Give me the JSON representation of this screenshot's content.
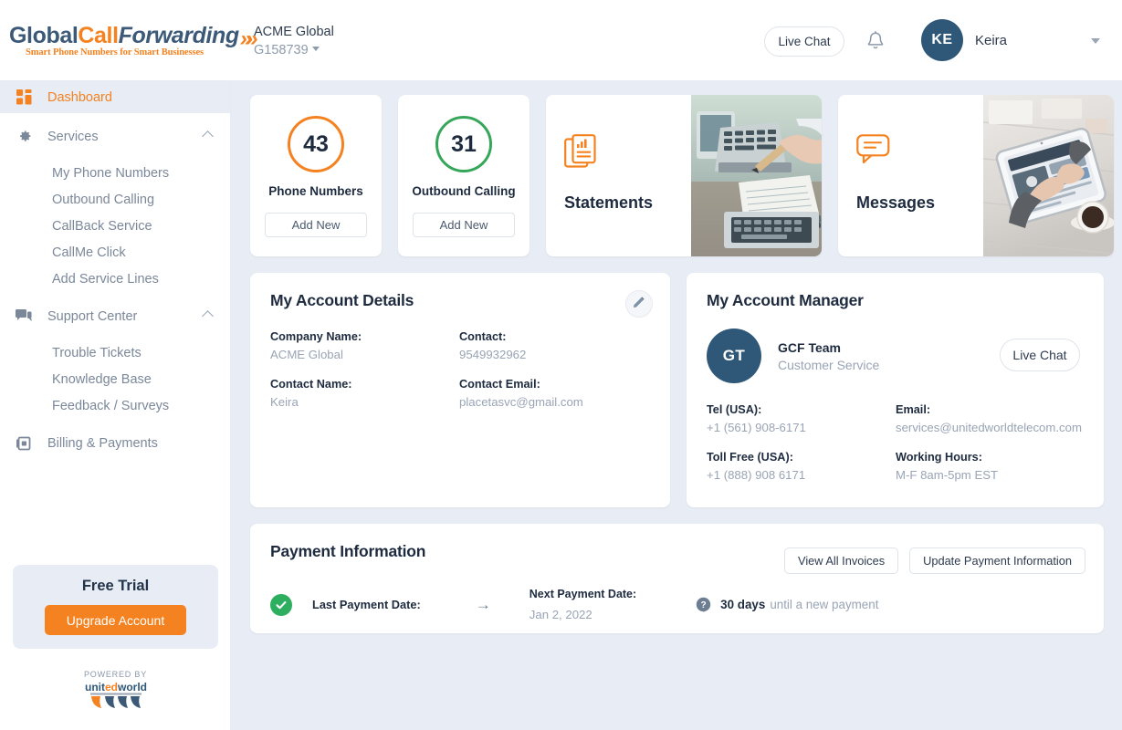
{
  "brand": {
    "logo_part1": "Global",
    "logo_part2": "Call",
    "logo_part3": "Forwarding",
    "logo_tagline": "Smart Phone Numbers for Smart Businesses"
  },
  "header": {
    "account_name": "ACME Global",
    "account_id": "G158739",
    "live_chat_label": "Live Chat",
    "user_initials": "KE",
    "user_name": "Keira"
  },
  "sidebar": {
    "items": [
      {
        "label": "Dashboard",
        "icon": "dashboard-icon",
        "active": true
      },
      {
        "label": "Services",
        "icon": "gear-icon",
        "expandable": true
      },
      {
        "label": "My Phone Numbers",
        "sub": true
      },
      {
        "label": "Outbound Calling",
        "sub": true
      },
      {
        "label": "CallBack Service",
        "sub": true
      },
      {
        "label": "CallMe Click",
        "sub": true
      },
      {
        "label": "Add Service Lines",
        "sub": true
      },
      {
        "label": "Support Center",
        "icon": "chat-icon",
        "expandable": true
      },
      {
        "label": "Trouble Tickets",
        "sub": true
      },
      {
        "label": "Knowledge Base",
        "sub": true
      },
      {
        "label": "Feedback / Surveys",
        "sub": true
      },
      {
        "label": "Billing & Payments",
        "icon": "billing-icon"
      }
    ],
    "trial": {
      "title": "Free Trial",
      "upgrade_label": "Upgrade Account"
    },
    "powered_by_label": "POWERED BY",
    "powered_by_brand": "unitedworld"
  },
  "stats": [
    {
      "value": "43",
      "label": "Phone Numbers",
      "button": "Add New",
      "color": "#f58220"
    },
    {
      "value": "31",
      "label": "Outbound Calling",
      "button": "Add New",
      "color": "#36a65a"
    }
  ],
  "promos": [
    {
      "title": "Statements",
      "icon": "documents-chart-icon"
    },
    {
      "title": "Messages",
      "icon": "speech-bubble-icon"
    }
  ],
  "account_details": {
    "title": "My Account Details",
    "fields": [
      {
        "key": "Company Name:",
        "value": "ACME Global"
      },
      {
        "key": "Contact:",
        "value": "9549932962"
      },
      {
        "key": "Contact Name:",
        "value": "Keira"
      },
      {
        "key": "Contact Email:",
        "value": "placetasvc@gmail.com"
      }
    ]
  },
  "account_manager": {
    "title": "My Account Manager",
    "initials": "GT",
    "name": "GCF Team",
    "role": "Customer Service",
    "live_chat_label": "Live Chat",
    "fields": [
      {
        "key": "Tel (USA):",
        "value": "+1 (561) 908-6171"
      },
      {
        "key": "Email:",
        "value": "services@unitedworldtelecom.com"
      },
      {
        "key": "Toll Free (USA):",
        "value": "+1 (888) 908 6171"
      },
      {
        "key": "Working Hours:",
        "value": "M-F 8am-5pm EST"
      }
    ]
  },
  "payment": {
    "title": "Payment Information",
    "view_invoices_label": "View All Invoices",
    "update_payment_label": "Update Payment Information",
    "last_payment_label": "Last Payment Date:",
    "next_payment_label": "Next Payment Date:",
    "next_payment_value": "Jan 2, 2022",
    "days_strong": "30 days",
    "days_rest": "until a new payment"
  },
  "colors": {
    "accent_orange": "#f58220",
    "brand_navy": "#2f5777",
    "success_green": "#2eae5f",
    "page_bg": "#e8ecf4"
  }
}
